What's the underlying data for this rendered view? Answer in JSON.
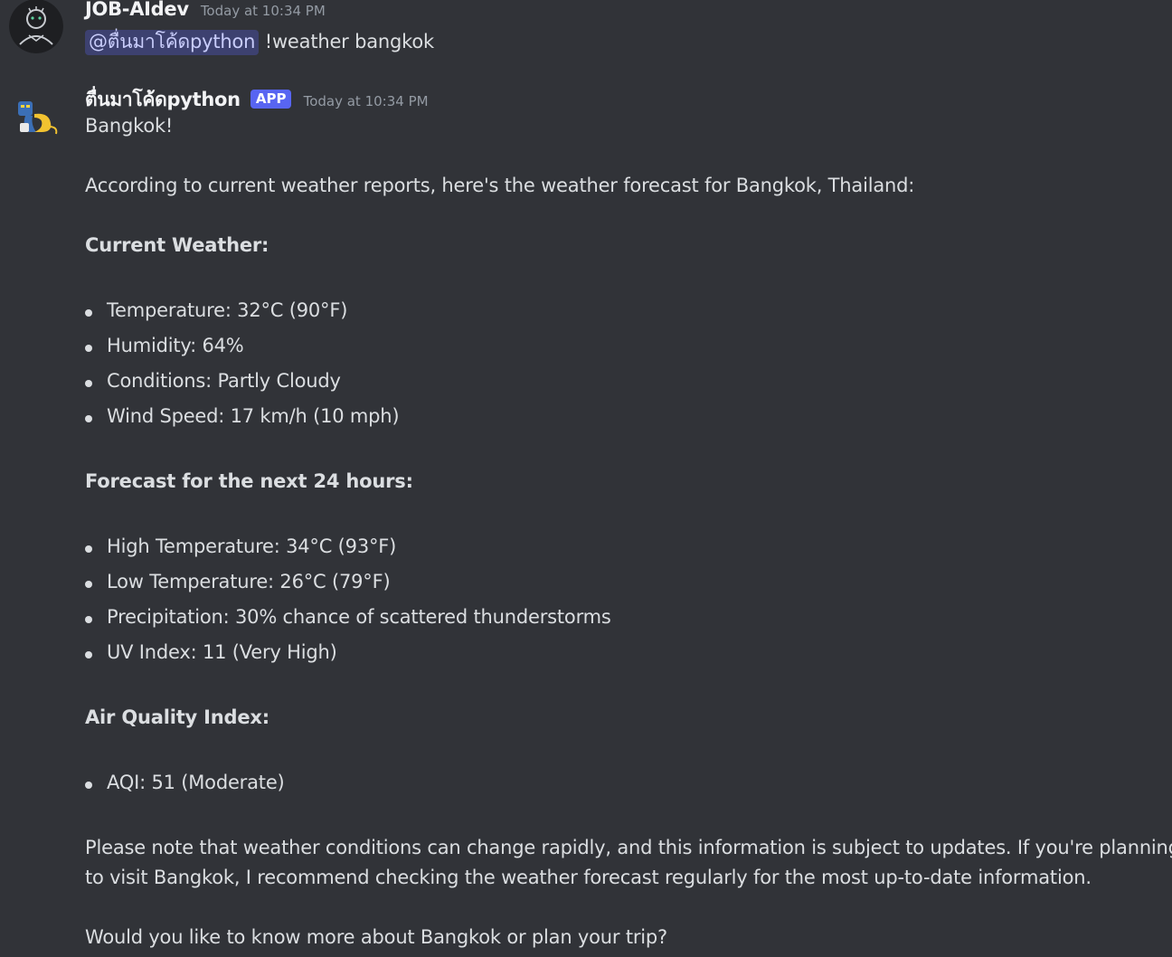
{
  "messages": [
    {
      "author": "JOB-AIdev",
      "timestamp": "Today at 10:34 PM",
      "mention": "@ตื่นมาโค้ดpython",
      "text": " !weather bangkok",
      "avatar_icon": "user-avatar-icon"
    },
    {
      "author": "ตื่นมาโค้ดpython",
      "tag": "APP",
      "timestamp": "Today at 10:34 PM",
      "avatar_icon": "bot-avatar-icon",
      "greeting": "Bangkok!",
      "intro": "According to current weather reports, here's the weather forecast for Bangkok, Thailand:",
      "sections": [
        {
          "heading": "Current Weather:",
          "items": [
            "Temperature: 32°C (90°F)",
            "Humidity: 64%",
            "Conditions: Partly Cloudy",
            "Wind Speed: 17 km/h (10 mph)"
          ]
        },
        {
          "heading": "Forecast for the next 24 hours:",
          "items": [
            "High Temperature: 34°C (93°F)",
            "Low Temperature: 26°C (79°F)",
            "Precipitation: 30% chance of scattered thunderstorms",
            "UV Index: 11 (Very High)"
          ]
        },
        {
          "heading": "Air Quality Index:",
          "items": [
            "AQI: 51 (Moderate)"
          ]
        }
      ],
      "note_line1": "Please note that weather conditions can change rapidly, and this information is subject to updates. If you're planning",
      "note_line2": "to visit Bangkok, I recommend checking the weather forecast regularly for the most up-to-date information.",
      "closing": "Would you like to know more about Bangkok or plan your trip?"
    }
  ],
  "colors": {
    "background": "#313338",
    "text": "#dbdee1",
    "muted": "#949ba4",
    "app_tag": "#5865f2",
    "mention_bg": "rgba(88,101,242,0.3)"
  }
}
